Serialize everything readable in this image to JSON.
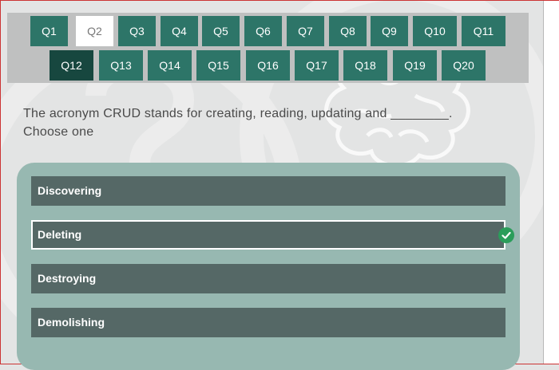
{
  "colors": {
    "nav_button": "#2d7568",
    "nav_answered": "#17473f",
    "nav_current": "#ffffff",
    "option_bg": "#556866",
    "panel_bg": "#97b8b1",
    "check": "#2a9d5a"
  },
  "nav": {
    "questions": [
      "Q1",
      "Q2",
      "Q3",
      "Q4",
      "Q5",
      "Q6",
      "Q7",
      "Q8",
      "Q9",
      "Q10",
      "Q11",
      "Q12",
      "Q13",
      "Q14",
      "Q15",
      "Q16",
      "Q17",
      "Q18",
      "Q19",
      "Q20"
    ],
    "current": "Q2",
    "answered": [
      "Q12"
    ]
  },
  "question": {
    "text": "The acronym CRUD stands for creating, reading, updating and ________.",
    "instruction": "Choose one"
  },
  "options": [
    {
      "label": "Discovering",
      "selected": false
    },
    {
      "label": "Deleting",
      "selected": true
    },
    {
      "label": "Destroying",
      "selected": false
    },
    {
      "label": "Demolishing",
      "selected": false
    }
  ],
  "icons": {
    "selected_marker": "check-circle-icon",
    "background": [
      "question-mark-icon",
      "brain-icon"
    ]
  }
}
